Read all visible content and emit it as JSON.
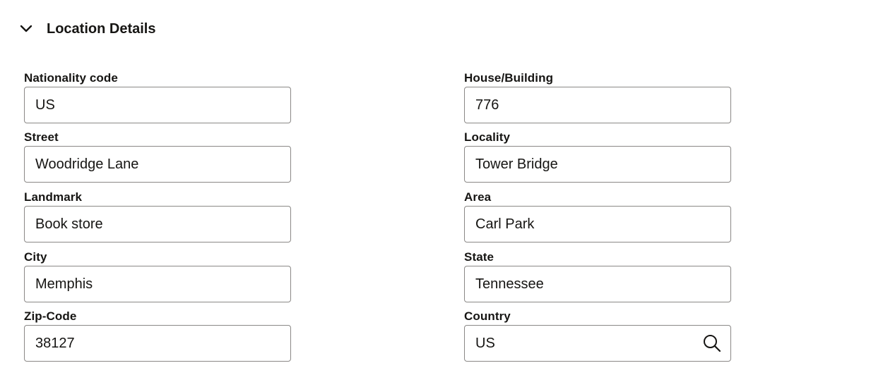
{
  "section": {
    "title": "Location Details",
    "toggle_icon": "chevron-down-icon"
  },
  "fields": {
    "nationality_code": {
      "label": "Nationality code",
      "value": "US"
    },
    "house_building": {
      "label": "House/Building",
      "value": "776"
    },
    "street": {
      "label": "Street",
      "value": "Woodridge Lane"
    },
    "locality": {
      "label": "Locality",
      "value": "Tower Bridge"
    },
    "landmark": {
      "label": "Landmark",
      "value": "Book store"
    },
    "area": {
      "label": "Area",
      "value": "Carl Park"
    },
    "city": {
      "label": "City",
      "value": "Memphis"
    },
    "state": {
      "label": "State",
      "value": "Tennessee"
    },
    "zip_code": {
      "label": "Zip-Code",
      "value": "38127"
    },
    "country": {
      "label": "Country",
      "value": "US",
      "icon": "search-icon"
    }
  },
  "colors": {
    "text": "#161513",
    "border": "#8a8886",
    "background": "#ffffff"
  }
}
